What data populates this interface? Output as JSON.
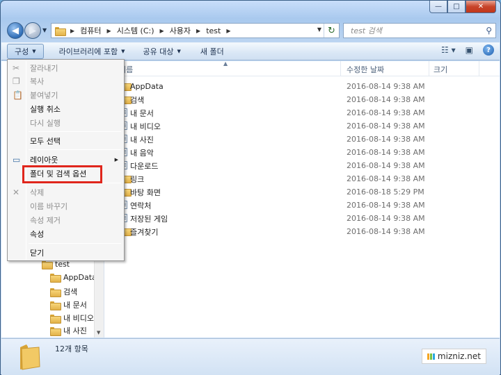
{
  "window": {
    "caption_buttons": {
      "minimize": "—",
      "maximize": "□",
      "close": "✕"
    }
  },
  "address_bar": {
    "crumbs": [
      "컴퓨터",
      "시스템 (C:)",
      "사용자",
      "test"
    ],
    "separator": "▶"
  },
  "search": {
    "placeholder": "test 검색"
  },
  "toolbar": {
    "organize": "구성",
    "include_in_library": "라이브러리에 포함",
    "share_with": "공유 대상",
    "new_folder": "새 폴더"
  },
  "columns": {
    "name": "이름",
    "date_modified": "수정한 날짜",
    "size": "크기"
  },
  "files": [
    {
      "name": "AppData",
      "date": "2016-08-14 9:38 AM"
    },
    {
      "name": "검색",
      "date": "2016-08-14 9:38 AM"
    },
    {
      "name": "내 문서",
      "date": "2016-08-14 9:38 AM"
    },
    {
      "name": "내 비디오",
      "date": "2016-08-14 9:38 AM"
    },
    {
      "name": "내 사진",
      "date": "2016-08-14 9:38 AM"
    },
    {
      "name": "내 음악",
      "date": "2016-08-14 9:38 AM"
    },
    {
      "name": "다운로드",
      "date": "2016-08-14 9:38 AM"
    },
    {
      "name": "링크",
      "date": "2016-08-14 9:38 AM"
    },
    {
      "name": "바탕 화면",
      "date": "2016-08-18 5:29 PM"
    },
    {
      "name": "연락처",
      "date": "2016-08-14 9:38 AM"
    },
    {
      "name": "저장된 게임",
      "date": "2016-08-14 9:38 AM"
    },
    {
      "name": "즐겨찾기",
      "date": "2016-08-14 9:38 AM"
    }
  ],
  "nav_tree": [
    {
      "name": "test"
    },
    {
      "name": "AppData"
    },
    {
      "name": "검색"
    },
    {
      "name": "내 문서"
    },
    {
      "name": "내 비디오"
    },
    {
      "name": "내 사진"
    }
  ],
  "organize_menu": {
    "cut": "잘라내기",
    "copy": "복사",
    "paste": "붙여넣기",
    "undo": "실행 취소",
    "redo": "다시 실행",
    "select_all": "모두 선택",
    "layout": "레이아웃",
    "folder_options": "폴더 및 검색 옵션",
    "delete": "삭제",
    "rename": "이름 바꾸기",
    "remove_properties": "속성 제거",
    "properties": "속성",
    "close": "닫기"
  },
  "status": {
    "item_count": "12개 항목"
  },
  "watermark": {
    "text": "mizniz.net"
  },
  "colors": {
    "highlight_border": "#e0261c",
    "window_frame": "#3b5f87",
    "toolbar_text": "#1e3250"
  }
}
